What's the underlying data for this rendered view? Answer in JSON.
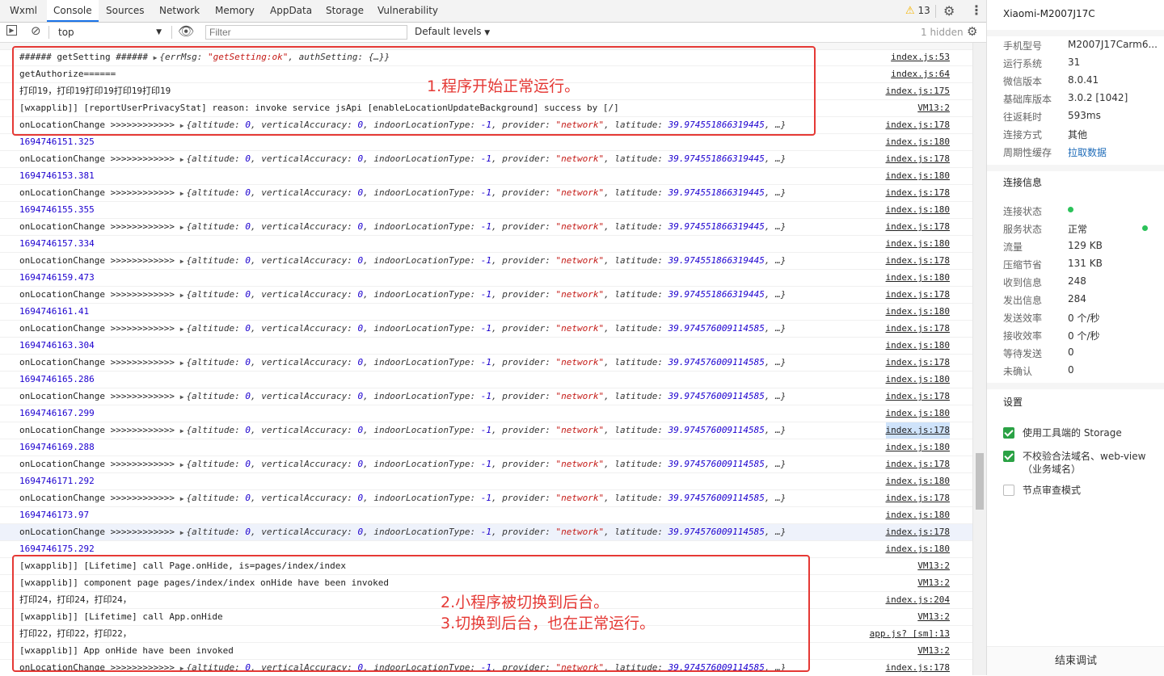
{
  "tabs": [
    "Wxml",
    "Console",
    "Sources",
    "Network",
    "Memory",
    "AppData",
    "Storage",
    "Vulnerability"
  ],
  "active_tab": "Console",
  "warnings_count": "13",
  "toolbar": {
    "context": "top",
    "filter_placeholder": "Filter",
    "levels": "Default levels",
    "hidden": "1 hidden"
  },
  "obj": {
    "setting_prefix": "{errMsg: ",
    "setting_str": "\"getSetting:ok\"",
    "setting_suffix": ", authSetting: {…}}",
    "loc_a": "{altitude: ",
    "loc_b": "0",
    "loc_c": ", verticalAccuracy: ",
    "loc_d": "0",
    "loc_e": ", indoorLocationType: ",
    "loc_f": "-1",
    "loc_g": ", provider: ",
    "loc_h": "\"network\"",
    "loc_i": ", latitude: ",
    "loc_k": ", …}",
    "lat1": "39.974551866319445",
    "lat2": "39.974576009114585"
  },
  "rows": [
    {
      "text": "###### getSetting ######",
      "src": "index.js:53",
      "kind": "setting"
    },
    {
      "text": "getAuthorize======",
      "src": "index.js:64",
      "kind": "text"
    },
    {
      "text": "打印19，打印19打印19打印19打印19",
      "src": "index.js:175",
      "kind": "text"
    },
    {
      "text": "[wxapplib]] [reportUserPrivacyStat] reason: invoke service jsApi [enableLocationUpdateBackground] success by [/]",
      "src": "VM13:2",
      "kind": "text"
    },
    {
      "text": "onLocationChange >>>>>>>>>>>>",
      "src": "index.js:178",
      "kind": "loc1"
    },
    {
      "text": "1694746151.325",
      "src": "index.js:180",
      "kind": "num"
    },
    {
      "text": "onLocationChange >>>>>>>>>>>>",
      "src": "index.js:178",
      "kind": "loc1"
    },
    {
      "text": "1694746153.381",
      "src": "index.js:180",
      "kind": "num"
    },
    {
      "text": "onLocationChange >>>>>>>>>>>>",
      "src": "index.js:178",
      "kind": "loc1"
    },
    {
      "text": "1694746155.355",
      "src": "index.js:180",
      "kind": "num"
    },
    {
      "text": "onLocationChange >>>>>>>>>>>>",
      "src": "index.js:178",
      "kind": "loc1"
    },
    {
      "text": "1694746157.334",
      "src": "index.js:180",
      "kind": "num"
    },
    {
      "text": "onLocationChange >>>>>>>>>>>>",
      "src": "index.js:178",
      "kind": "loc1"
    },
    {
      "text": "1694746159.473",
      "src": "index.js:180",
      "kind": "num"
    },
    {
      "text": "onLocationChange >>>>>>>>>>>>",
      "src": "index.js:178",
      "kind": "loc1"
    },
    {
      "text": "1694746161.41",
      "src": "index.js:180",
      "kind": "num"
    },
    {
      "text": "onLocationChange >>>>>>>>>>>>",
      "src": "index.js:178",
      "kind": "loc2"
    },
    {
      "text": "1694746163.304",
      "src": "index.js:180",
      "kind": "num"
    },
    {
      "text": "onLocationChange >>>>>>>>>>>>",
      "src": "index.js:178",
      "kind": "loc2"
    },
    {
      "text": "1694746165.286",
      "src": "index.js:180",
      "kind": "num"
    },
    {
      "text": "onLocationChange >>>>>>>>>>>>",
      "src": "index.js:178",
      "kind": "loc2"
    },
    {
      "text": "1694746167.299",
      "src": "index.js:180",
      "kind": "num"
    },
    {
      "text": "onLocationChange >>>>>>>>>>>>",
      "src": "index.js:178",
      "kind": "loc2",
      "srcsel": true
    },
    {
      "text": "1694746169.288",
      "src": "index.js:180",
      "kind": "num"
    },
    {
      "text": "onLocationChange >>>>>>>>>>>>",
      "src": "index.js:178",
      "kind": "loc2"
    },
    {
      "text": "1694746171.292",
      "src": "index.js:180",
      "kind": "num"
    },
    {
      "text": "onLocationChange >>>>>>>>>>>>",
      "src": "index.js:178",
      "kind": "loc2"
    },
    {
      "text": "1694746173.97",
      "src": "index.js:180",
      "kind": "num"
    },
    {
      "text": "onLocationChange >>>>>>>>>>>>",
      "src": "index.js:178",
      "kind": "loc2",
      "hl": true
    },
    {
      "text": "1694746175.292",
      "src": "index.js:180",
      "kind": "num"
    },
    {
      "text": "[wxapplib]] [Lifetime] call Page.onHide, is=pages/index/index",
      "src": "VM13:2",
      "kind": "text"
    },
    {
      "text": "[wxapplib]] component page pages/index/index onHide have been invoked",
      "src": "VM13:2",
      "kind": "text"
    },
    {
      "text": "打印24，打印24，打印24，",
      "src": "index.js:204",
      "kind": "text"
    },
    {
      "text": "[wxapplib]] [Lifetime] call App.onHide",
      "src": "VM13:2",
      "kind": "text"
    },
    {
      "text": "打印22，打印22，打印22，",
      "src": "app.js? [sm]:13",
      "kind": "text"
    },
    {
      "text": "[wxapplib]] App onHide have been invoked",
      "src": "VM13:2",
      "kind": "text"
    },
    {
      "text": "onLocationChange >>>>>>>>>>>>",
      "src": "index.js:178",
      "kind": "loc2"
    }
  ],
  "annotations": {
    "a1": "1.程序开始正常运行。",
    "a2": "2.小程序被切换到后台。",
    "a3": "3.切换到后台，也在正常运行。"
  },
  "panel": {
    "device": "Xiaomi-M2007J17C",
    "info": [
      {
        "k": "手机型号",
        "v": "M2007J17Carm6..."
      },
      {
        "k": "运行系统",
        "v": "31"
      },
      {
        "k": "微信版本",
        "v": "8.0.41"
      },
      {
        "k": "基础库版本",
        "v": "3.0.2 [1042]"
      },
      {
        "k": "往返耗时",
        "v": "593ms"
      },
      {
        "k": "连接方式",
        "v": "其他"
      },
      {
        "k": "周期性缓存",
        "v": "拉取数据"
      }
    ],
    "conn_title": "连接信息",
    "conn": [
      {
        "k": "连接状态",
        "v": ""
      },
      {
        "k": "服务状态",
        "v": "正常"
      },
      {
        "k": "流量",
        "v": "129 KB"
      },
      {
        "k": "压缩节省",
        "v": "131 KB"
      },
      {
        "k": "收到信息",
        "v": "248"
      },
      {
        "k": "发出信息",
        "v": "284"
      },
      {
        "k": "发送效率",
        "v": "0 个/秒"
      },
      {
        "k": "接收效率",
        "v": "0 个/秒"
      },
      {
        "k": "等待发送",
        "v": "0"
      },
      {
        "k": "未确认",
        "v": "0"
      }
    ],
    "settings_title": "设置",
    "settings": [
      {
        "label": "使用工具端的 Storage",
        "checked": true
      },
      {
        "label": "不校验合法域名、web-view（业务域名）",
        "checked": true
      },
      {
        "label": "节点审查模式",
        "checked": false
      }
    ],
    "end_button": "结束调试"
  },
  "colors": {
    "accent": "#1a73e8",
    "annotation": "#e53935",
    "check": "#2ba245",
    "status_dot": "#2cc25a"
  }
}
